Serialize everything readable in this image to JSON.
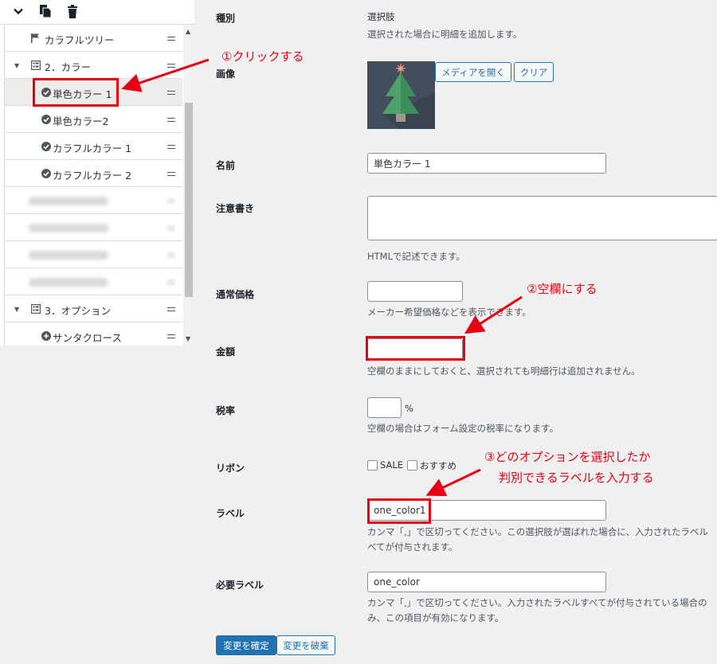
{
  "toolbar": {
    "icons": [
      "chevron-down-icon",
      "duplicate-icon",
      "trash-icon"
    ]
  },
  "tree": {
    "items": [
      {
        "label": "カラフルツリー",
        "icon": "flag-icon"
      },
      {
        "label": "2．カラー",
        "icon": "group-icon"
      },
      {
        "label": "単色カラー 1",
        "icon": "check-circle-icon",
        "selected": true
      },
      {
        "label": "単色カラー2",
        "icon": "check-circle-icon"
      },
      {
        "label": "カラフルカラー 1",
        "icon": "check-circle-icon"
      },
      {
        "label": "カラフルカラー 2",
        "icon": "check-circle-icon"
      },
      {
        "label": "3．オプション",
        "icon": "group-icon"
      },
      {
        "label": "サンタクロース",
        "icon": "plus-circle-icon"
      }
    ]
  },
  "form": {
    "type": {
      "label": "種別",
      "value": "選択肢",
      "help": "選択された場合に明細を追加します。"
    },
    "image": {
      "label": "画像",
      "open_button": "メディアを開く",
      "clear_button": "クリア"
    },
    "name": {
      "label": "名前",
      "value": "単色カラー 1"
    },
    "note": {
      "label": "注意書き",
      "value": "",
      "help": "HTMLで記述できます。"
    },
    "regular_price": {
      "label": "通常価格",
      "value": "",
      "help": "メーカー希望価格などを表示できます。"
    },
    "amount": {
      "label": "金額",
      "value": "",
      "help": "空欄のままにしておくと、選択されても明細行は追加されません。"
    },
    "tax_rate": {
      "label": "税率",
      "value": "",
      "unit": "%",
      "help": "空欄の場合はフォーム設定の税率になります。"
    },
    "ribbon": {
      "label": "リボン",
      "options": [
        "SALE",
        "おすすめ"
      ]
    },
    "tag": {
      "label": "ラベル",
      "value": "one_color1",
      "help_line1": "カンマ「,」で区切ってください。この選択肢が選ばれた場合に、入力されたラベル",
      "help_line2": "べてが付与されます。"
    },
    "required_tag": {
      "label": "必要ラベル",
      "value": "one_color",
      "help_line1": "カンマ「,」で区切ってください。入力されたラベルすべてが付与されている場合の",
      "help_line2": "み、この項目が有効になります。"
    },
    "confirm_button": "変更を確定",
    "discard_button": "変更を破棄"
  },
  "annotations": {
    "step1": "①クリックする",
    "step2": "②空欄にする",
    "step3_line1": "③どのオプションを選択したか",
    "step3_line2": "判別できるラベルを入力する"
  },
  "colors": {
    "accent": "#2271b1",
    "annotation": "#e60012"
  }
}
